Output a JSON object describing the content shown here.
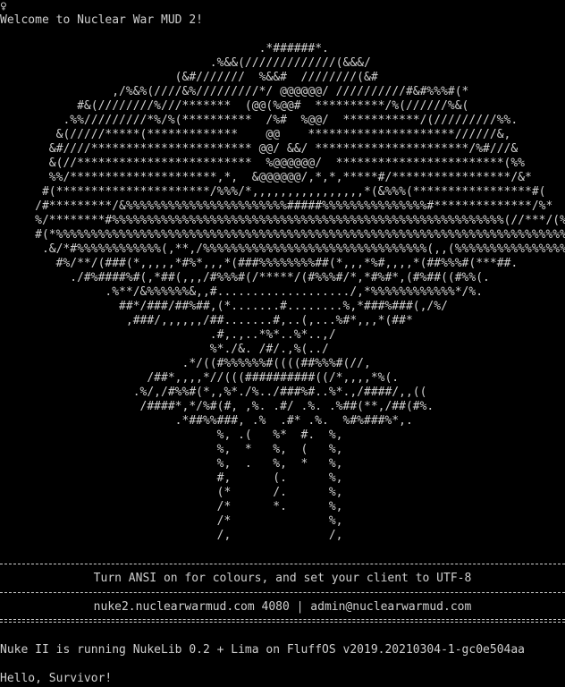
{
  "terminal": {
    "cursor_glyph": "♀",
    "welcome": "Welcome to Nuclear War MUD 2!",
    "ascii_art": [
      "                                     .*######*.",
      "                              .%&&(/////////////(&&&/",
      "                         (&#///////  %&&#  ////////(&#",
      "                ,/%&%(////&%/////////*/ @@@@@@/ //////////#&#%%%#(*",
      "           #&(////////%///*******  (@@(%@@#  **********/%(//////%&(",
      "         .%%/////////*%/%(**********  /%#  %@@/  ***********/(/////////%%.",
      "        &(/////*****(*************    @@    *********************//////&,",
      "       &#////*********************** @@/ &&/ **********************/%#///&",
      "       &(//*************************  %@@@@@@/  ************************(%%",
      "       %%/*********************,*,  &@@@@@@/,*,*,*****#/*****************/&*",
      "      #(**********************/%%%/*,,,,,,,,,,,,,,,,*(&%%%(*****************#(",
      "     /#*********/&%%%%%%%%%%%%%%%%%%%%%%%#####%%%%%%%%%%%%%%%#**************/%*",
      "     %/********#%%%%%%%%%%%%%%%%%%%%%%%%%%%%%%%%%%%%%%%%%%%%%%%%%%%%%%%%(//***/(%%/#(",
      "     #(*%%%%%%%%%%%%%%%%%%%%%%%%%%%%%%%%%%%%%%%%%%%%%%%%%%%%%%%%%%%%%%%%%%%%%%%%%%#*#/",
      "      .&/*#%%%%%%%%%%%%(,**,/%%%%%%%%%%%%%%%%%%%%%%%%%%%%%%%%(,,(%%%%%%%%%%%%%%%%%%/*#(",
      "        #%/**/(###(*,,,,,*#%*,,,*(###%%%%%%%%##(*,,,*%#,,,,*(##%%%#(***##.",
      "          ./#%####%#(,*##(,,,/#%%%#(/*****/(#%%%#/*,*#%#*,(#%##((#%%(.",
      "               .%**/&%%%%%%&,,#.................../,*%%%%%%%%%%%%*/%.",
      "                 ##*/###/##%##,(*.......#........%,*###%###(,/%/",
      "                  ,###/,,,,,,/##.......#,..(,...%#*,,,*(##*",
      "                              .#,.,..*%*..%*..,/",
      "                              %*./&. /#/.,%(../",
      "                          .*/((#%%%%%%#((((##%%%#(//,",
      "                     /##*,,,,*//(((##########((/*,,,,*%(.",
      "                   .%/,/#%%#(*,,%*./%../###%#..%*.,/####/,,((",
      "                    /####*,*/%#(#, ,%. .#/ .%. .%##(**,/##(#%.",
      "                         .*##%%###, .%  .#* .%.  %#%###%*,.",
      "                               %, .(   %*  #.  %,",
      "                               %,  *   %,  (   %,",
      "                               %,  .   %,  *   %,",
      "                               #,      (.      %,",
      "                               (*      /.      %,",
      "                               /*      *.      %,",
      "                               /*              %,",
      "                               /,              /,"
    ],
    "ansi_notice": "Turn ANSI on for colours, and set your client to UTF-8",
    "contact_line": "nuke2.nuclearwarmud.com 4080 | admin@nuclearwarmud.com",
    "driver_info": "Nuke II is running NukeLib 0.2 + Lima on FluffOS v2019.20210304-1-gc0e504aa",
    "greeting": "Hello, Survivor!"
  }
}
